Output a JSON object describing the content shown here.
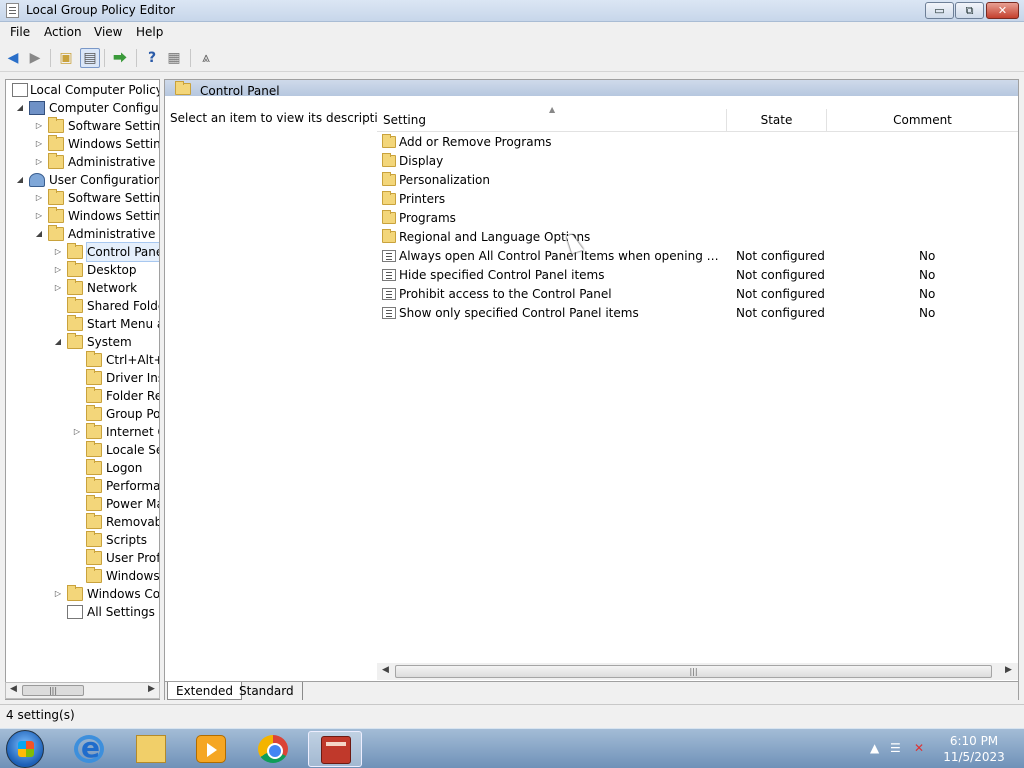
{
  "window": {
    "title": "Local Group Policy Editor"
  },
  "window_controls": {
    "minimize": "▭",
    "maximize": "⧉",
    "close": "✕"
  },
  "menu": [
    "File",
    "Action",
    "View",
    "Help"
  ],
  "tree": {
    "items": [
      {
        "label": "Local Computer Policy",
        "toggle": "",
        "icon": "policy"
      },
      {
        "label": "Computer Configura",
        "toggle": "◢",
        "icon": "computer"
      },
      {
        "label": "Software Settings",
        "toggle": "▷",
        "icon": "folder"
      },
      {
        "label": "Windows Settings",
        "toggle": "▷",
        "icon": "folder"
      },
      {
        "label": "Administrative Te",
        "toggle": "▷",
        "icon": "folder"
      },
      {
        "label": "User Configuration",
        "toggle": "◢",
        "icon": "user"
      },
      {
        "label": "Software Settings",
        "toggle": "▷",
        "icon": "folder"
      },
      {
        "label": "Windows Settings",
        "toggle": "▷",
        "icon": "folder"
      },
      {
        "label": "Administrative Te",
        "toggle": "◢",
        "icon": "folder"
      },
      {
        "label": "Control Panel",
        "toggle": "▷",
        "icon": "folder"
      },
      {
        "label": "Desktop",
        "toggle": "▷",
        "icon": "folder"
      },
      {
        "label": "Network",
        "toggle": "▷",
        "icon": "folder"
      },
      {
        "label": "Shared Folder",
        "toggle": "",
        "icon": "folder"
      },
      {
        "label": "Start Menu ar",
        "toggle": "",
        "icon": "folder"
      },
      {
        "label": "System",
        "toggle": "◢",
        "icon": "folder"
      },
      {
        "label": "Ctrl+Alt+I",
        "toggle": "",
        "icon": "folder"
      },
      {
        "label": "Driver Inst",
        "toggle": "",
        "icon": "folder"
      },
      {
        "label": "Folder Rec",
        "toggle": "",
        "icon": "folder"
      },
      {
        "label": "Group Pol",
        "toggle": "",
        "icon": "folder"
      },
      {
        "label": "Internet C",
        "toggle": "▷",
        "icon": "folder"
      },
      {
        "label": "Locale Ser",
        "toggle": "",
        "icon": "folder"
      },
      {
        "label": "Logon",
        "toggle": "",
        "icon": "folder"
      },
      {
        "label": "Performar",
        "toggle": "",
        "icon": "folder"
      },
      {
        "label": "Power Ma",
        "toggle": "",
        "icon": "folder"
      },
      {
        "label": "Removabl",
        "toggle": "",
        "icon": "folder"
      },
      {
        "label": "Scripts",
        "toggle": "",
        "icon": "folder"
      },
      {
        "label": "User Profi",
        "toggle": "",
        "icon": "folder"
      },
      {
        "label": "Windows",
        "toggle": "",
        "icon": "folder"
      },
      {
        "label": "Windows Cor",
        "toggle": "▷",
        "icon": "folder"
      },
      {
        "label": "All Settings",
        "toggle": "",
        "icon": "all-settings"
      }
    ],
    "selected": "Control Panel"
  },
  "right_pane": {
    "header": "Control Panel",
    "description": "Select an item to view its description.",
    "columns": {
      "setting": "Setting",
      "state": "State",
      "comment": "Comment"
    },
    "rows": [
      {
        "name": "Add or Remove Programs",
        "state": "",
        "comment": "",
        "type": "folder"
      },
      {
        "name": "Display",
        "state": "",
        "comment": "",
        "type": "folder"
      },
      {
        "name": "Personalization",
        "state": "",
        "comment": "",
        "type": "folder"
      },
      {
        "name": "Printers",
        "state": "",
        "comment": "",
        "type": "folder"
      },
      {
        "name": "Programs",
        "state": "",
        "comment": "",
        "type": "folder"
      },
      {
        "name": "Regional and Language Options",
        "state": "",
        "comment": "",
        "type": "folder"
      },
      {
        "name": "Always open All Control Panel Items when opening Control ...",
        "state": "Not configured",
        "comment": "No",
        "type": "setting"
      },
      {
        "name": "Hide specified Control Panel items",
        "state": "Not configured",
        "comment": "No",
        "type": "setting"
      },
      {
        "name": "Prohibit access to the Control Panel",
        "state": "Not configured",
        "comment": "No",
        "type": "setting"
      },
      {
        "name": "Show only specified Control Panel items",
        "state": "Not configured",
        "comment": "No",
        "type": "setting"
      }
    ],
    "tabs": [
      "Extended",
      "Standard"
    ],
    "active_tab": "Extended"
  },
  "statusbar": {
    "text": "4 setting(s)"
  },
  "taskbar": {
    "apps": [
      "internet-explorer",
      "windows-explorer",
      "media-player",
      "chrome",
      "group-policy-editor"
    ],
    "active_app": "group-policy-editor",
    "clock_time": "6:10 PM",
    "clock_date": "11/5/2023"
  },
  "colors": {
    "tree_selected": "#e5effb",
    "header_bg": "#c9d6e8",
    "taskbar": "#7d9cc2"
  }
}
